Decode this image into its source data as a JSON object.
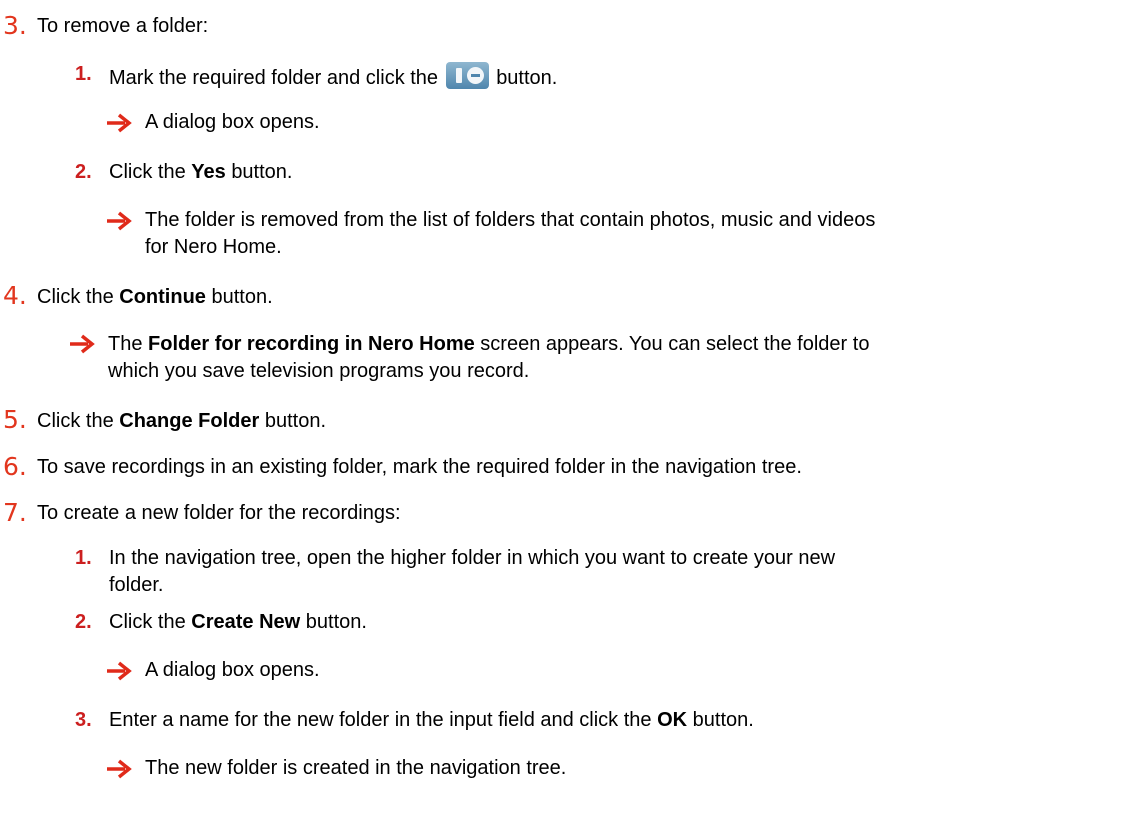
{
  "colors": {
    "step_number": "#e2361e",
    "substep_number": "#cc1f1f",
    "arrow": "#e02a1a"
  },
  "steps": [
    {
      "number": "3.",
      "text": "To remove a folder:",
      "substeps": [
        {
          "number": "1.",
          "before": "Mark the required folder and click the",
          "icon": "remove-folder-button-icon",
          "after": "button.",
          "results": [
            "A dialog box opens."
          ]
        },
        {
          "number": "2.",
          "before": "Click the",
          "bold": "Yes",
          "after": "button.",
          "results": [
            "The folder is removed from the list of folders that contain photos, music and videos",
            "for Nero Home."
          ]
        }
      ]
    },
    {
      "number": "4.",
      "before": "Click the",
      "bold": "Continue",
      "after": "button.",
      "result": {
        "before": "The",
        "bold": "Folder for recording in Nero Home",
        "after": "screen appears. You can select the folder to",
        "line2": "which you save television programs you record."
      }
    },
    {
      "number": "5.",
      "before": "Click the",
      "bold": "Change Folder",
      "after": "button."
    },
    {
      "number": "6.",
      "text": "To save recordings in an existing folder, mark the required folder in the navigation tree."
    },
    {
      "number": "7.",
      "text": "To create a new folder for the recordings:",
      "substeps": [
        {
          "number": "1.",
          "lines": [
            "In the navigation tree, open the higher folder in which you want to create your new",
            "folder."
          ]
        },
        {
          "number": "2.",
          "before": "Click the",
          "bold": "Create New",
          "after": "button.",
          "results": [
            "A dialog box opens."
          ]
        },
        {
          "number": "3.",
          "before": "Enter a name for the new folder in the input field and click the",
          "bold": "OK",
          "after": "button.",
          "results": [
            "The new folder is created in the navigation tree."
          ]
        }
      ]
    }
  ]
}
